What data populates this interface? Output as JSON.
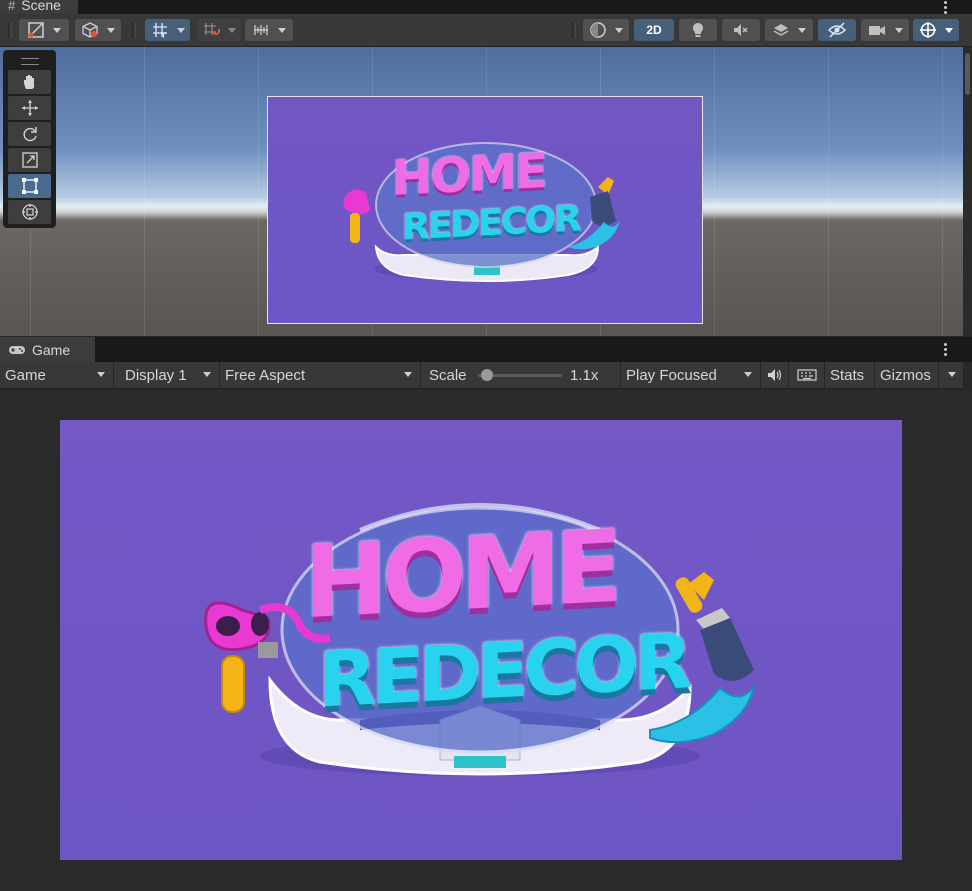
{
  "scene_tab": {
    "label": "Scene"
  },
  "scene_toolbar": {
    "mode_2d_label": "2D"
  },
  "scene_tools": [
    "hand-tool",
    "move-tool",
    "rotate-tool",
    "scale-tool",
    "rect-tool",
    "transform-tool"
  ],
  "game_tab": {
    "label": "Game"
  },
  "game_toolbar": {
    "view_dropdown": "Game",
    "display_dropdown": "Display 1",
    "aspect_dropdown": "Free Aspect",
    "scale_label": "Scale",
    "scale_value": "1.1x",
    "play_mode_dropdown": "Play Focused",
    "stats_label": "Stats",
    "gizmos_label": "Gizmos"
  },
  "logo": {
    "line1": "HOME",
    "line2": "REDECOR"
  },
  "colors": {
    "scene_bg_purple": "#7257c4",
    "game_bg_purple": "#7358c6",
    "logo_pink": "#f06be6",
    "logo_cyan": "#27d3ee",
    "selected_blue": "#46607c"
  }
}
